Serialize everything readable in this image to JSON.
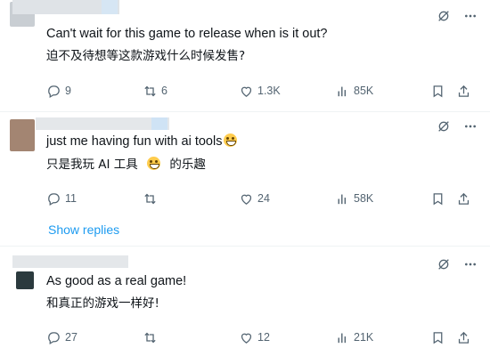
{
  "colors": {
    "accent": "#1d9bf0",
    "muted": "#536471",
    "text": "#0f1419",
    "divider": "#eff3f4"
  },
  "tweets": [
    {
      "text_en": "Can't wait for this game to release when is it out?",
      "text_cn": "迫不及待想等这款游戏什么时候发售?",
      "stats": {
        "replies": "9",
        "reposts": "6",
        "likes": "1.3K",
        "views": "85K"
      }
    },
    {
      "text_en": "just me having fun with ai tools",
      "text_cn_before": "只是我玩 AI 工具",
      "text_cn_after": "的乐趣",
      "stats": {
        "replies": "11",
        "reposts": "",
        "likes": "24",
        "views": "58K"
      }
    },
    {
      "text_en": "As good as a real game!",
      "text_cn": "和真正的游戏一样好!",
      "stats": {
        "replies": "27",
        "reposts": "",
        "likes": "12",
        "views": "21K"
      }
    }
  ],
  "show_replies_label": "Show replies",
  "icons": {
    "reply": "reply-icon",
    "repost": "repost-icon",
    "like": "like-icon",
    "views": "views-icon",
    "bookmark": "bookmark-icon",
    "share": "share-icon",
    "grok": "grok-icon",
    "more": "more-icon"
  }
}
